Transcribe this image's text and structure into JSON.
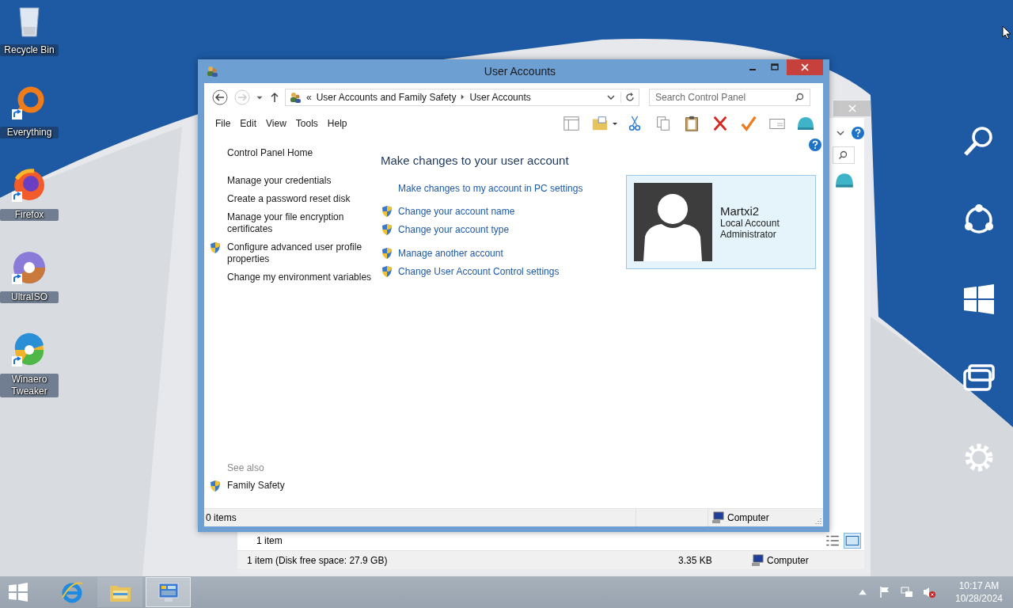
{
  "desktop_icons": [
    {
      "label": "Recycle Bin",
      "kind": "bin",
      "shortcut": false
    },
    {
      "label": "Everything",
      "kind": "ring",
      "shortcut": true
    },
    {
      "label": "Firefox",
      "kind": "fox",
      "shortcut": true
    },
    {
      "label": "UltraISO",
      "kind": "disc",
      "shortcut": true
    },
    {
      "label": "Winaero Tweaker",
      "kind": "swirl",
      "shortcut": true
    }
  ],
  "back_window": {
    "items_count": "1 item",
    "status_text": "1 item (Disk free space: 27.9 GB)",
    "size": "3.35 KB",
    "location": "Computer"
  },
  "window": {
    "title": "User Accounts",
    "nav": {
      "forward_disabled": true,
      "breadcrumb": [
        "User Accounts and Family Safety",
        "User Accounts"
      ],
      "overflow": "«"
    },
    "search": {
      "placeholder": "Search Control Panel"
    },
    "menu": [
      "File",
      "Edit",
      "View",
      "Tools",
      "Help"
    ],
    "sidebar": {
      "home": "Control Panel Home",
      "tasks": [
        {
          "label": "Manage your credentials",
          "shield": false
        },
        {
          "label": "Create a password reset disk",
          "shield": false
        },
        {
          "label": "Manage your file encryption certificates",
          "shield": false
        },
        {
          "label": "Configure advanced user profile properties",
          "shield": true
        },
        {
          "label": "Change my environment variables",
          "shield": false
        }
      ],
      "see_also": {
        "heading": "See also",
        "links": [
          {
            "label": "Family Safety",
            "shield": true
          }
        ]
      }
    },
    "heading": "Make changes to your user account",
    "link_groups": [
      [
        {
          "label": "Make changes to my account in PC settings",
          "shield": false
        }
      ],
      [
        {
          "label": "Change your account name",
          "shield": true
        },
        {
          "label": "Change your account type",
          "shield": true
        }
      ],
      [
        {
          "label": "Manage another account",
          "shield": true
        },
        {
          "label": "Change User Account Control settings",
          "shield": true
        }
      ]
    ],
    "account": {
      "name": "Martxi2",
      "type": "Local Account",
      "role": "Administrator"
    },
    "status_bar": {
      "items": "0 items",
      "location": "Computer"
    }
  },
  "taskbar": {
    "apps": [
      {
        "kind": "browser",
        "selected": false
      },
      {
        "kind": "folder",
        "selected": false
      },
      {
        "kind": "panel",
        "selected": true
      }
    ],
    "volume_muted": true,
    "time": "10:17 AM",
    "date": "10/28/2024"
  }
}
